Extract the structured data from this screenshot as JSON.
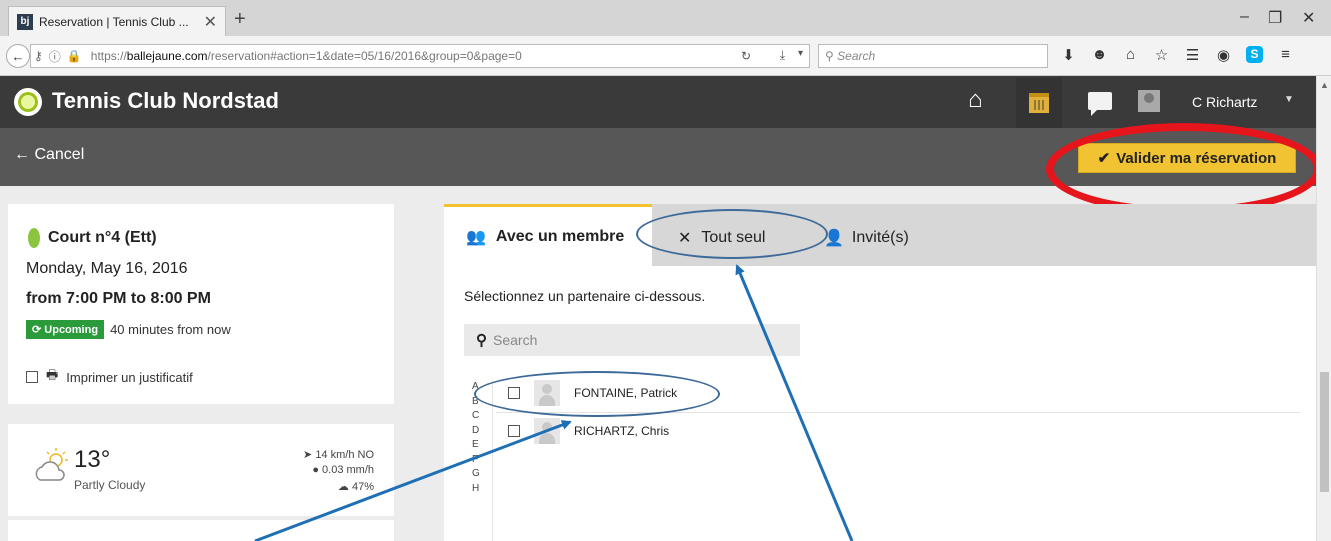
{
  "browser": {
    "tab_title": "Reservation | Tennis Club ...",
    "tab_favicon": "bj",
    "url_host": "ballejaune.com",
    "url_prefix": "https://",
    "url_suffix": "/reservation#action=1&date=05/16/2016&group=0&page=0",
    "search_placeholder": "Search"
  },
  "header": {
    "app_name": "Tennis Club Nordstad",
    "user_name": "C Richartz"
  },
  "action_bar": {
    "cancel_label": "Cancel",
    "validate_label": "Valider ma réservation"
  },
  "reservation": {
    "court": "Court n°4 (Ett)",
    "date": "Monday, May 16, 2016",
    "time": "from 7:00 PM to 8:00 PM",
    "status_badge": "Upcoming",
    "status_text": "40 minutes from now",
    "print_label": "Imprimer un justificatif"
  },
  "weather": {
    "temperature": "13°",
    "description": "Partly Cloudy",
    "wind": "14 km/h NO",
    "rain": "0.03 mm/h",
    "cloud": "47%"
  },
  "tabs": {
    "member": "Avec un membre",
    "alone": "Tout seul",
    "guest": "Invité(s)"
  },
  "partner": {
    "instruction": "Sélectionnez un partenaire ci-dessous.",
    "search_placeholder": "Search",
    "alphabet": [
      "A",
      "B",
      "C",
      "D",
      "E",
      "F",
      "G",
      "H"
    ],
    "members": [
      "FONTAINE, Patrick",
      "RICHARTZ, Chris"
    ]
  },
  "colors": {
    "accent": "#f1c232",
    "highlight_red": "#e6141b",
    "annotation_blue": "#1f6fb5",
    "upcoming_green": "#2a9a3a"
  }
}
